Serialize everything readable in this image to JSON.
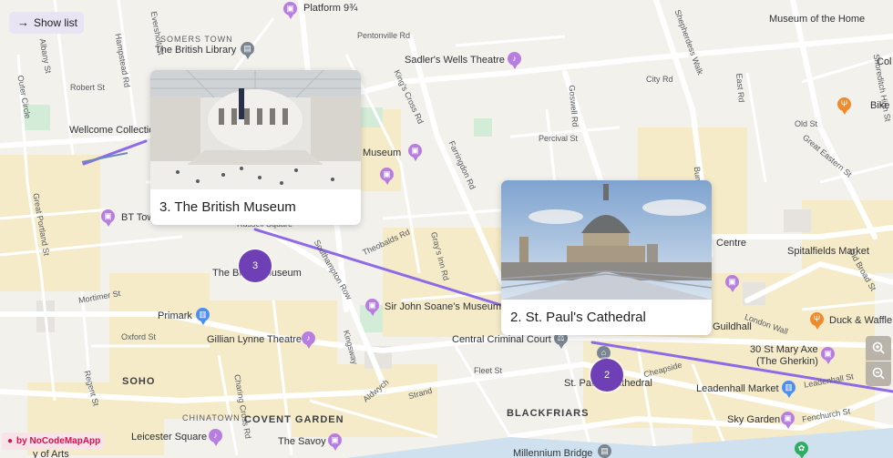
{
  "toolbar": {
    "show_list_label": "Show list"
  },
  "zoom": {
    "in_label": "+",
    "out_label": "−"
  },
  "credit": {
    "label": "by NoCodeMapApp"
  },
  "stops": [
    {
      "number": "3",
      "title": "3. The British Museum"
    },
    {
      "number": "2",
      "title": "2. St. Paul's Cathedral"
    }
  ],
  "labels": {
    "platform": "Platform 9¾",
    "somers_town": "SOMERS TOWN",
    "british_library": "The British Library",
    "pentonville": "Pentonville Rd",
    "sadlers": "Sadler's Wells Theatre",
    "museum_home": "Museum of the Home",
    "city_rd": "City Rd",
    "wellcome": "Wellcome Collection",
    "robert_st": "Robert St",
    "percival": "Percival St",
    "bike_she": "Bike She",
    "old_st": "Old St",
    "um_museum": "Museum",
    "great_eastern": "Great Eastern St",
    "shoreditch": "Shoreditch High St",
    "bt_tower": "BT Tow",
    "russell_sq": "Russell Square",
    "theobalds": "Theobalds Rd",
    "grays_inn": "Gray's Inn Rd",
    "centre": "Centre",
    "spitalfields": "Spitalfields Market",
    "bm_label": "The British Museum",
    "southampton": "Southampton Row",
    "soane": "Sir John Soane's Museum",
    "primark": "Primark",
    "mortimer": "Mortimer St",
    "london_wall": "London Wall",
    "guildhall": "Guildhall",
    "duck_waffle": "Duck & Waffle",
    "gillian": "Gillian Lynne Theatre",
    "oxford_st": "Oxford St",
    "central_criminal": "Central Criminal Court",
    "mary_axe": "30 St Mary Axe",
    "gherkin": "(The Gherkin)",
    "soho": "SOHO",
    "fleet_st": "Fleet St",
    "cheapside": "Cheapside",
    "leadenhall_st": "Leadenhall St",
    "st_paul_label": "St. Paul's Cathedral",
    "leadenhall_market": "Leadenhall Market",
    "strand": "Strand",
    "aldwych": "Aldwych",
    "kingsway": "Kingsway",
    "chinatown": "CHINATOWN",
    "covent_garden": "COVENT GARDEN",
    "blackfriars": "BLACKFRIARS",
    "sky_garden": "Sky Garden",
    "fenchurch": "Fenchurch St",
    "leicester": "Leicester Square",
    "savoy": "The Savoy",
    "millennium": "Millennium Bridge",
    "arts": "y of Arts",
    "kings_cross_rd": "King's Cross Rd",
    "farringdon": "Farringdon Rd",
    "goswell": "Goswell Rd",
    "bunhill": "Bunhill",
    "shepherdess": "Shepherdess Walk",
    "east_rd": "East Rd",
    "great_portland": "Great Portland St",
    "euston": "Euston Rd",
    "everholt": "Eversholt St",
    "hampstead": "Hampstead Rd",
    "albany": "Albany St",
    "outer_circle": "Outer Circle",
    "regent_st": "Regent St",
    "charing_cross": "Charing Cross Rd",
    "old_broad": "Old Broad St",
    "cole": "Col"
  }
}
